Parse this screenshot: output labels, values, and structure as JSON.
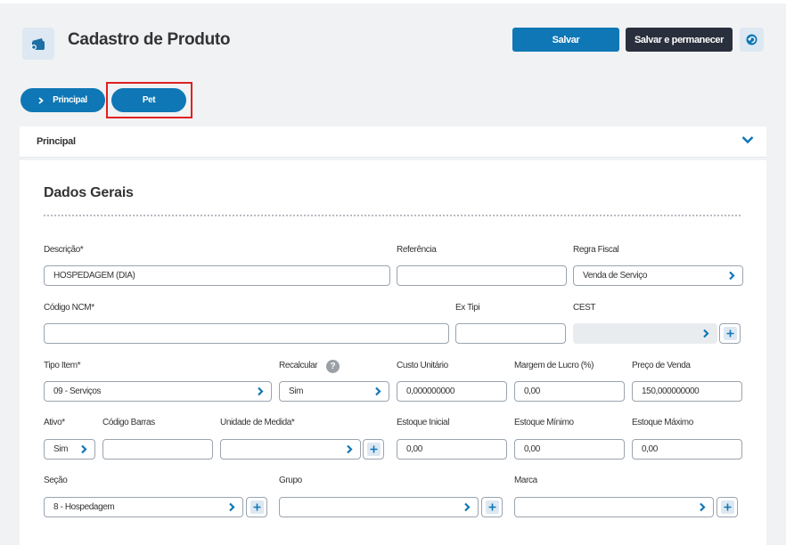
{
  "header": {
    "title": "Cadastro de Produto",
    "save_label": "Salvar",
    "save_stay_label": "Salvar e permanecer",
    "back_icon": "undo-icon",
    "app_icon": "wallet-icon"
  },
  "tabs": [
    {
      "label": "Principal",
      "icon": "chevron-right-icon"
    },
    {
      "label": "Pet"
    }
  ],
  "section": {
    "label": "Principal",
    "collapsed": false
  },
  "card": {
    "title": "Dados Gerais",
    "fields": {
      "descricao": {
        "label": "Descrição*",
        "value": "HOSPEDAGEM (DIA)"
      },
      "referencia": {
        "label": "Referência",
        "value": ""
      },
      "regra_fiscal": {
        "label": "Regra Fiscal",
        "value": "Venda de Serviço"
      },
      "codigo_ncm": {
        "label": "Código NCM*",
        "value": ""
      },
      "ex_tipi": {
        "label": "Ex Tipi",
        "value": ""
      },
      "cest": {
        "label": "CEST",
        "value": ""
      },
      "tipo_item": {
        "label": "Tipo Item*",
        "value": "09 - Serviços"
      },
      "recalcular": {
        "label": "Recalcular",
        "value": "Sim",
        "help": "?"
      },
      "custo_unitario": {
        "label": "Custo Unitário",
        "value": "0,000000000"
      },
      "margem_lucro": {
        "label": "Margem de Lucro (%)",
        "value": "0,00"
      },
      "preco_venda": {
        "label": "Preço de Venda",
        "value": "150,000000000"
      },
      "ativo": {
        "label": "Ativo*",
        "value": "Sim"
      },
      "codigo_barras": {
        "label": "Código Barras",
        "value": ""
      },
      "unidade_medida": {
        "label": "Unidade de Medida*",
        "value": ""
      },
      "estoque_inicial": {
        "label": "Estoque Inicial",
        "value": "0,00"
      },
      "estoque_minimo": {
        "label": "Estoque Mínimo",
        "value": "0,00"
      },
      "estoque_maximo": {
        "label": "Estoque Máximo",
        "value": "0,00"
      },
      "secao": {
        "label": "Seção",
        "value": "8 - Hospedagem"
      },
      "grupo": {
        "label": "Grupo",
        "value": ""
      },
      "marca": {
        "label": "Marca",
        "value": ""
      }
    }
  },
  "colors": {
    "primary": "#0f77b5",
    "dark": "#2a2f3d",
    "highlight": "#e02020",
    "icon_bg": "#dde8f2"
  }
}
